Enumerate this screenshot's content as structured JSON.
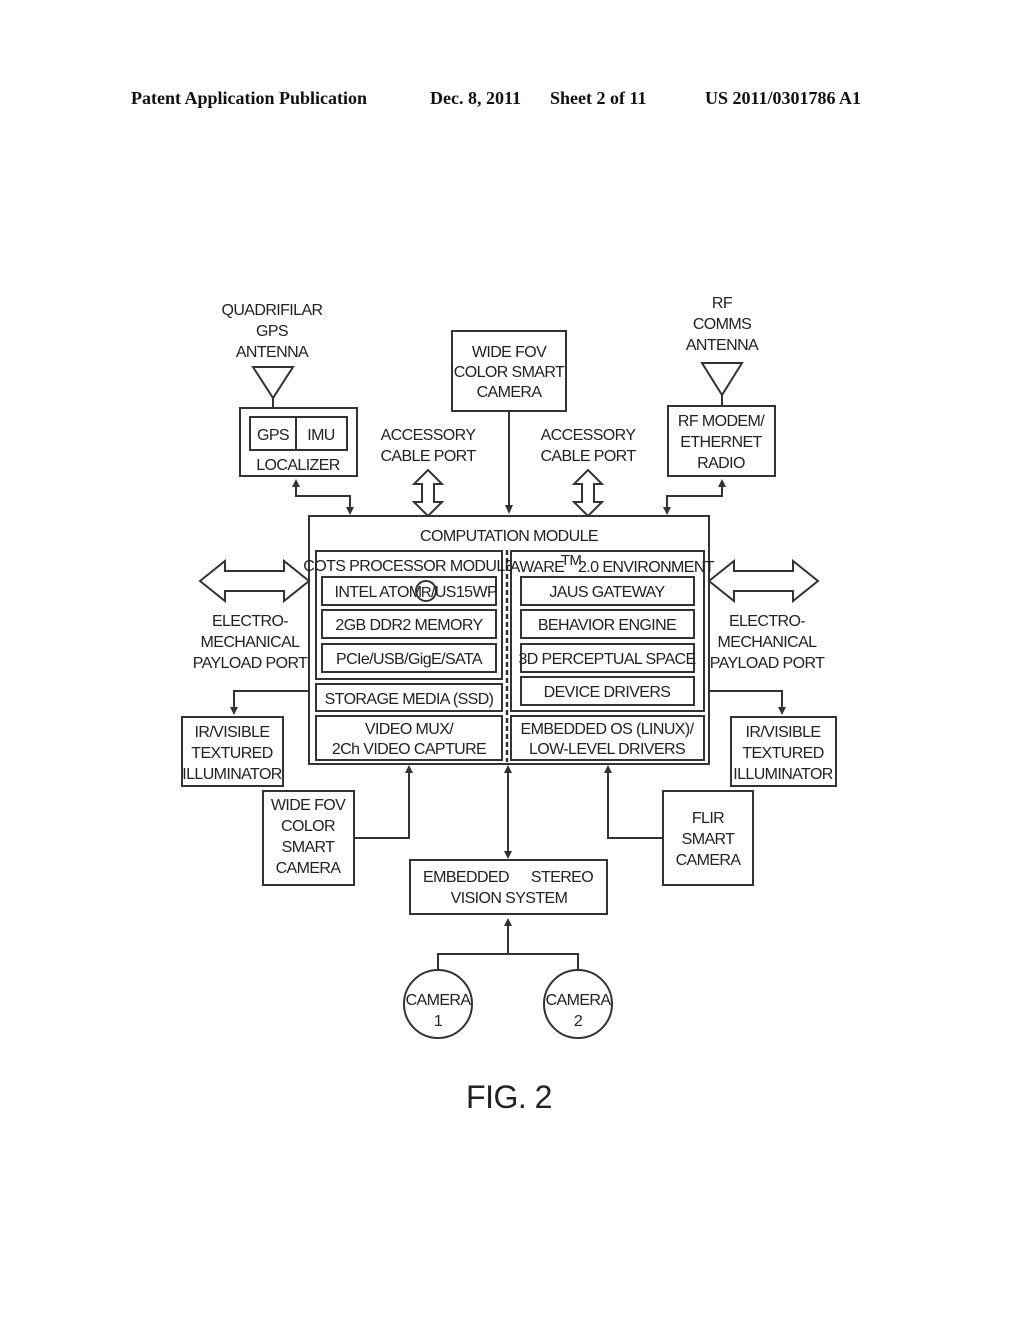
{
  "header": {
    "publication": "Patent Application Publication",
    "date": "Dec. 8, 2011",
    "sheet": "Sheet 2 of 11",
    "number": "US 2011/0301786 A1"
  },
  "gps_antenna": {
    "lines": [
      "QUADRIFILAR",
      "GPS",
      "ANTENNA"
    ]
  },
  "localizer": {
    "gps": "GPS",
    "imu": "IMU",
    "label": "LOCALIZER"
  },
  "top_camera": {
    "lines": [
      "WIDE FOV",
      "COLOR SMART",
      "CAMERA"
    ]
  },
  "rf_antenna": {
    "lines": [
      "RF",
      "COMMS",
      "ANTENNA"
    ]
  },
  "rf_modem": {
    "lines": [
      "RF MODEM/",
      "ETHERNET",
      "RADIO"
    ]
  },
  "accessory_port_left": {
    "lines": [
      "ACCESSORY",
      "CABLE PORT"
    ]
  },
  "accessory_port_right": {
    "lines": [
      "ACCESSORY",
      "CABLE PORT"
    ]
  },
  "computation_module": {
    "title": "COMPUTATION MODULE",
    "cots": {
      "title": "COTS PROCESSOR MODULE",
      "items": [
        "INTEL ATOM",
        "/US15WP",
        "2GB DDR2 MEMORY",
        "PCIe/USB/GigE/SATA"
      ],
      "registered_symbol": "R"
    },
    "storage": "STORAGE MEDIA (SSD)",
    "video_mux": [
      "VIDEO MUX/",
      "2Ch VIDEO CAPTURE"
    ],
    "aware": {
      "title_pre": "AWARE",
      "tm": "TM",
      "title_post": "2.0 ENVIRONMENT",
      "items": [
        "JAUS GATEWAY",
        "BEHAVIOR ENGINE",
        "3D PERCEPTUAL SPACE",
        "DEVICE DRIVERS"
      ]
    },
    "embedded_os": [
      "EMBEDDED OS (LINUX)/",
      "LOW-LEVEL DRIVERS"
    ]
  },
  "payload_port_left": {
    "lines": [
      "ELECTRO-",
      "MECHANICAL",
      "PAYLOAD PORT"
    ]
  },
  "payload_port_right": {
    "lines": [
      "ELECTRO-",
      "MECHANICAL",
      "PAYLOAD PORT"
    ]
  },
  "illuminator_left": {
    "lines": [
      "IR/VISIBLE",
      "TEXTURED",
      "ILLUMINATOR"
    ]
  },
  "illuminator_right": {
    "lines": [
      "IR/VISIBLE",
      "TEXTURED",
      "ILLUMINATOR"
    ]
  },
  "bottom_left_camera": {
    "lines": [
      "WIDE FOV",
      "COLOR",
      "SMART",
      "CAMERA"
    ]
  },
  "flir_camera": {
    "lines": [
      "FLIR",
      "SMART",
      "CAMERA"
    ]
  },
  "stereo_vision": {
    "line1_a": "EMBEDDED",
    "line1_b": "STEREO",
    "line2": "VISION SYSTEM"
  },
  "camera1": {
    "lines": [
      "CAMERA",
      "1"
    ]
  },
  "camera2": {
    "lines": [
      "CAMERA",
      "2"
    ]
  },
  "figure_label": "FIG. 2"
}
